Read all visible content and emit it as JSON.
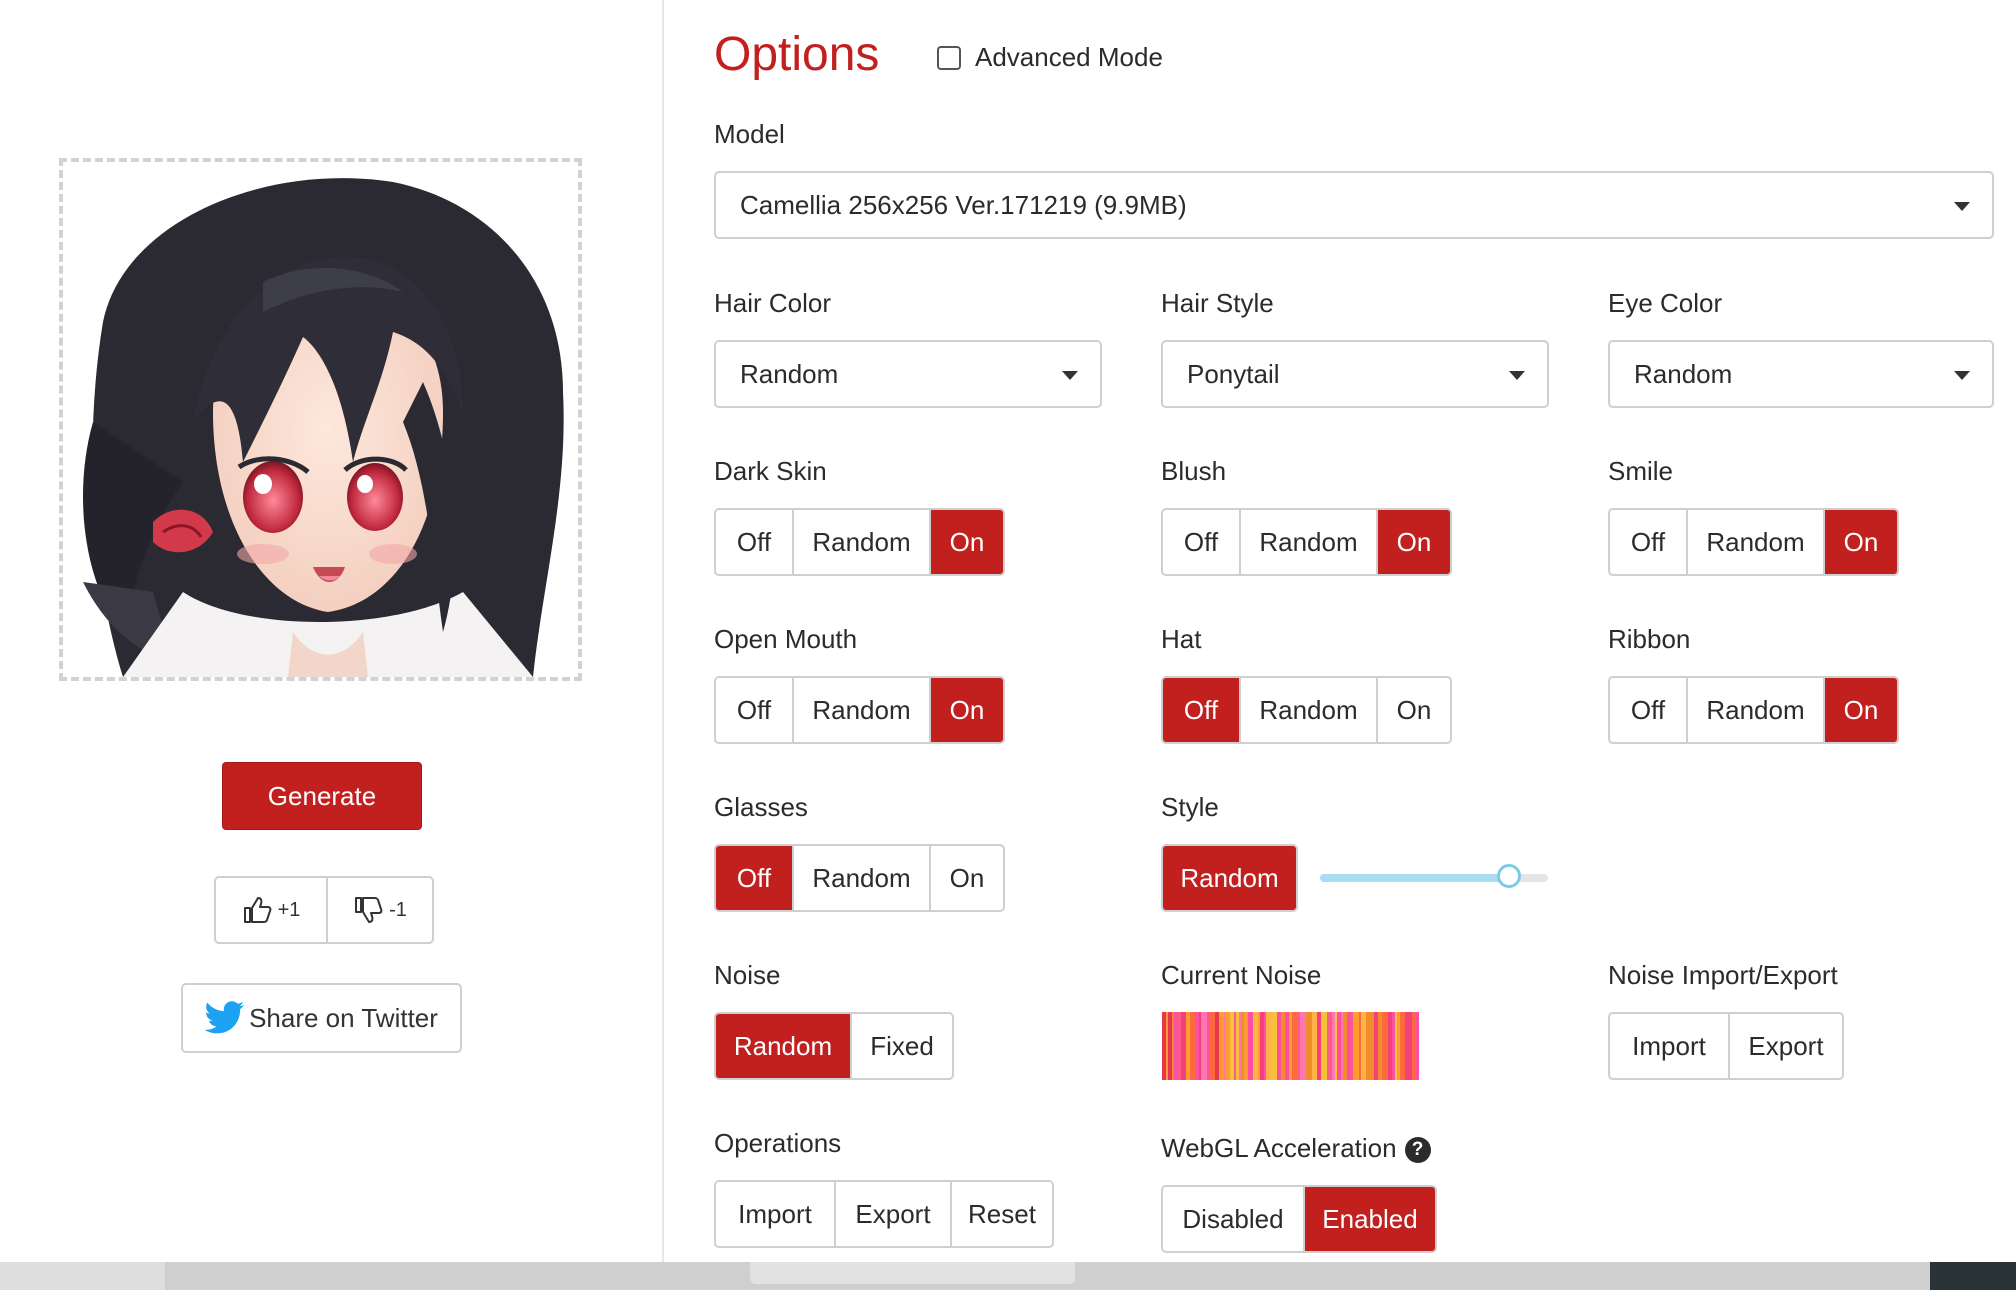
{
  "colors": {
    "accent": "#c2201e",
    "border": "#cfcfcf",
    "slider": "#a9dcf2"
  },
  "left": {
    "generate_label": "Generate",
    "upvote_label": "+1",
    "downvote_label": "-1",
    "share_label": "Share on Twitter"
  },
  "options": {
    "title": "Options",
    "advanced_mode_label": "Advanced Mode",
    "advanced_mode_checked": false,
    "model": {
      "label": "Model",
      "value": "Camellia 256x256 Ver.171219 (9.9MB)"
    },
    "hair_color": {
      "label": "Hair Color",
      "value": "Random"
    },
    "hair_style": {
      "label": "Hair Style",
      "value": "Ponytail"
    },
    "eye_color": {
      "label": "Eye Color",
      "value": "Random"
    },
    "toggles": {
      "dark_skin": {
        "label": "Dark Skin",
        "options": [
          "Off",
          "Random",
          "On"
        ],
        "selected": "On"
      },
      "blush": {
        "label": "Blush",
        "options": [
          "Off",
          "Random",
          "On"
        ],
        "selected": "On"
      },
      "smile": {
        "label": "Smile",
        "options": [
          "Off",
          "Random",
          "On"
        ],
        "selected": "On"
      },
      "open_mouth": {
        "label": "Open Mouth",
        "options": [
          "Off",
          "Random",
          "On"
        ],
        "selected": "On"
      },
      "hat": {
        "label": "Hat",
        "options": [
          "Off",
          "Random",
          "On"
        ],
        "selected": "Off"
      },
      "ribbon": {
        "label": "Ribbon",
        "options": [
          "Off",
          "Random",
          "On"
        ],
        "selected": "On"
      },
      "glasses": {
        "label": "Glasses",
        "options": [
          "Off",
          "Random",
          "On"
        ],
        "selected": "Off"
      }
    },
    "style": {
      "label": "Style",
      "button_label": "Random",
      "slider_value": 0.83
    },
    "noise": {
      "label": "Noise",
      "options": [
        "Random",
        "Fixed"
      ],
      "selected": "Random"
    },
    "current_noise_label": "Current Noise",
    "noise_io": {
      "label": "Noise Import/Export",
      "import_label": "Import",
      "export_label": "Export"
    },
    "operations": {
      "label": "Operations",
      "import_label": "Import",
      "export_label": "Export",
      "reset_label": "Reset"
    },
    "webgl": {
      "label": "WebGL Acceleration",
      "help_icon": "question-circle-icon",
      "options": [
        "Disabled",
        "Enabled"
      ],
      "selected": "Enabled"
    }
  }
}
